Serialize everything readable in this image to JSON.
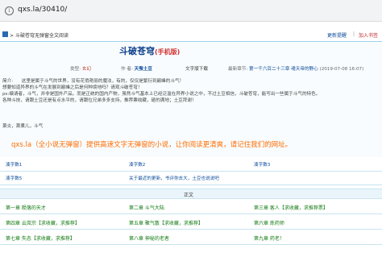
{
  "browser": {
    "url": "qxs.la/30410/"
  },
  "breadcrumb": {
    "text": "斗破苍穹无弹窗全文阅读",
    "updates": "更新提醒",
    "separator": "|",
    "add_bookmark": "加入书签"
  },
  "book": {
    "title": "斗破苍穹",
    "subtitle": "(手机版)",
    "category_label": "类型:",
    "category": "玄幻",
    "author_label": "作 者:",
    "author": "天蚕土豆",
    "download": "文字版下载",
    "latest_label": "最新章节:",
    "latest_chapter": "第一千六百二十三章 魂天帝的野心",
    "latest_time": "(2019-07-08 16:07)"
  },
  "intro": {
    "label": "简介:",
    "lines": [
      "这里是属于斗气的世界，没有花俏艳丽的魔法，有的，仅仅是繁衍到巅峰的斗气！",
      "想要知道异界的斗气在发展到巅峰之后是何种境地吗？请观斗破苍穹！",
      "ps:编请者，斗气，并非是国外产品，而是正统的国内产物，虽然斗气基本上已经泛滥在异界小说之中，不过土豆相信，斗破苍穹，能写出一些属于斗气的特色。",
      "各种斗技，请跟土豆还是有点水平的，请跟位兄弟多多支持，推荐票收藏，砸的满地；土豆拜谢！"
    ],
    "tags": "萧炎，萧薰儿，斗气"
  },
  "promo": "qxs.la（全小说无弹窗）提供高速文字无弹窗的小说，让你阅读更清爽，请记住我们的网址。",
  "extras": [
    [
      "凑字数1",
      "凑字数2",
      "凑字数3"
    ],
    [
      "凑字数5",
      "关于最近的更新，书评你去大，土豆也说说吧",
      ""
    ]
  ],
  "section_title": "正文",
  "chapters": [
    [
      "第一章 陨落的天才",
      "第二章 斗气大陆",
      "第三章 客人【求收藏，求推荐票】"
    ],
    [
      "第四章 云岚宗【求收藏，求推荐】",
      "第五章 聚气散【求收藏，求推荐】",
      "第六章 炼药师"
    ],
    [
      "第七章 失态【求收藏，求推荐】",
      "第八章 神秘的老者",
      "第九章 药老！"
    ]
  ]
}
